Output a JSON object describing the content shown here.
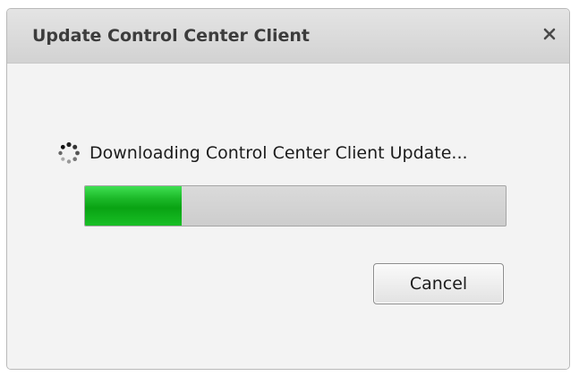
{
  "window": {
    "title": "Update Control Center Client",
    "close_icon": "close-icon"
  },
  "status": {
    "icon": "loading-spinner-icon",
    "text": "Downloading Control Center Client Update..."
  },
  "progress": {
    "fraction": 0.23,
    "fill_color": "#17b324"
  },
  "buttons": {
    "cancel_label": "Cancel"
  }
}
